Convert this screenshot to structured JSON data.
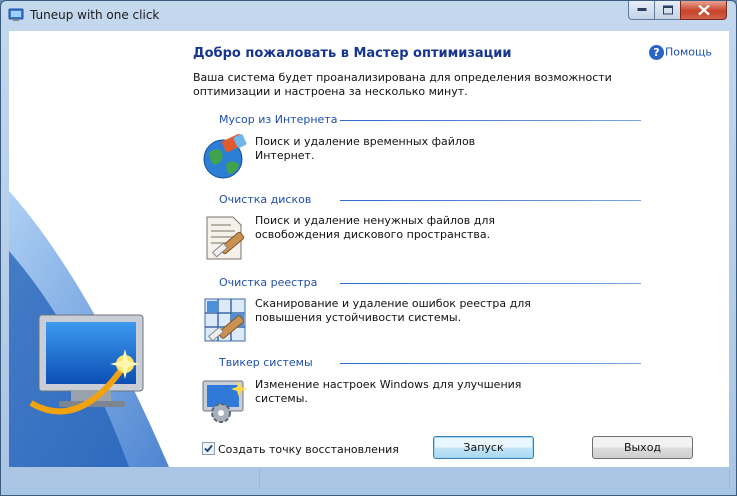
{
  "window": {
    "title": "Tuneup with one click"
  },
  "header": {
    "heading": "Добро пожаловать в Мастер оптимизации",
    "help_label": "Помощь",
    "intro": "Ваша система будет проанализирована для определения возможности оптимизации и настроена за несколько минут."
  },
  "sections": [
    {
      "title": "Мусор из Интернета",
      "icon": "globe-eraser-icon",
      "text_line1": "Поиск и удаление временных файлов",
      "text_line2": "Интернет."
    },
    {
      "title": "Очистка дисков",
      "icon": "document-brush-icon",
      "text_line1": "Поиск и удаление ненужных файлов для",
      "text_line2": "освобождения дискового пространства."
    },
    {
      "title": "Очистка реестра",
      "icon": "registry-brush-icon",
      "text_line1": "Сканирование и удаление ошибок реестра для",
      "text_line2": "повышения устойчивости системы."
    },
    {
      "title": "Твикер системы",
      "icon": "monitor-gear-icon",
      "text_line1": "Изменение настроек Windows для улучшения",
      "text_line2": "системы."
    }
  ],
  "footer": {
    "restore_label": "Создать точку восстановления",
    "restore_checked": true,
    "start_label": "Запуск",
    "exit_label": "Выход"
  },
  "colors": {
    "heading": "#16358f",
    "section_title": "#1f4fa5",
    "accent": "#2a64c5"
  }
}
